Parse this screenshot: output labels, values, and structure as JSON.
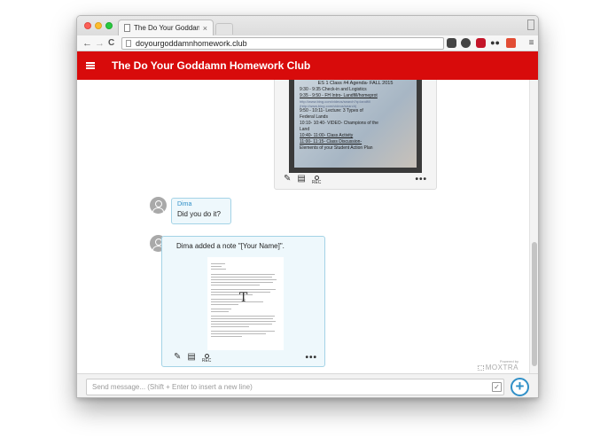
{
  "browser": {
    "tab_title": "The Do Your Goddamn Ho",
    "tab_close": "×",
    "address": "doyourgoddamnhomework.club",
    "nav_back": "←",
    "nav_forward": "→",
    "nav_reload": "C",
    "menu_icon": "≡"
  },
  "app": {
    "title_prefix": "The ",
    "title": "The Do Your Goddamn Homework Club"
  },
  "photo_card": {
    "lines": [
      "ES 1 Class #4 Agenda- FALL 2015",
      "9:30 -   9:35 Check-in and Logistics",
      "9:35 -   9:50 - FH Intro- Landfill/homeprot",
      "http://www.bing.com/videos/search?q=landfill",
      "(http://www.bing.com/videos/search)",
      "9:50 -   10:11- Lecture: 3 Types of",
      "Federal Lands",
      "10:10- 10:40- VIDEO- Champions of the",
      "Land",
      "10:40- 11:00- Class Activity",
      "11:00- 11:15- Class Discussion-",
      "Elements of your Student Action Plan"
    ],
    "rec_label": "REC",
    "more_label": "•••"
  },
  "message": {
    "sender": "Dima",
    "text": "Did you do it?"
  },
  "note": {
    "text": "Dima added a note \"[Your Name]\".",
    "rec_label": "REC",
    "more_label": "•••"
  },
  "branding": {
    "powered_by": "Powered by",
    "name": "MOXTRA"
  },
  "composer": {
    "placeholder": "Send message... (Shift + Enter to insert a new line)",
    "add_label": "+"
  }
}
